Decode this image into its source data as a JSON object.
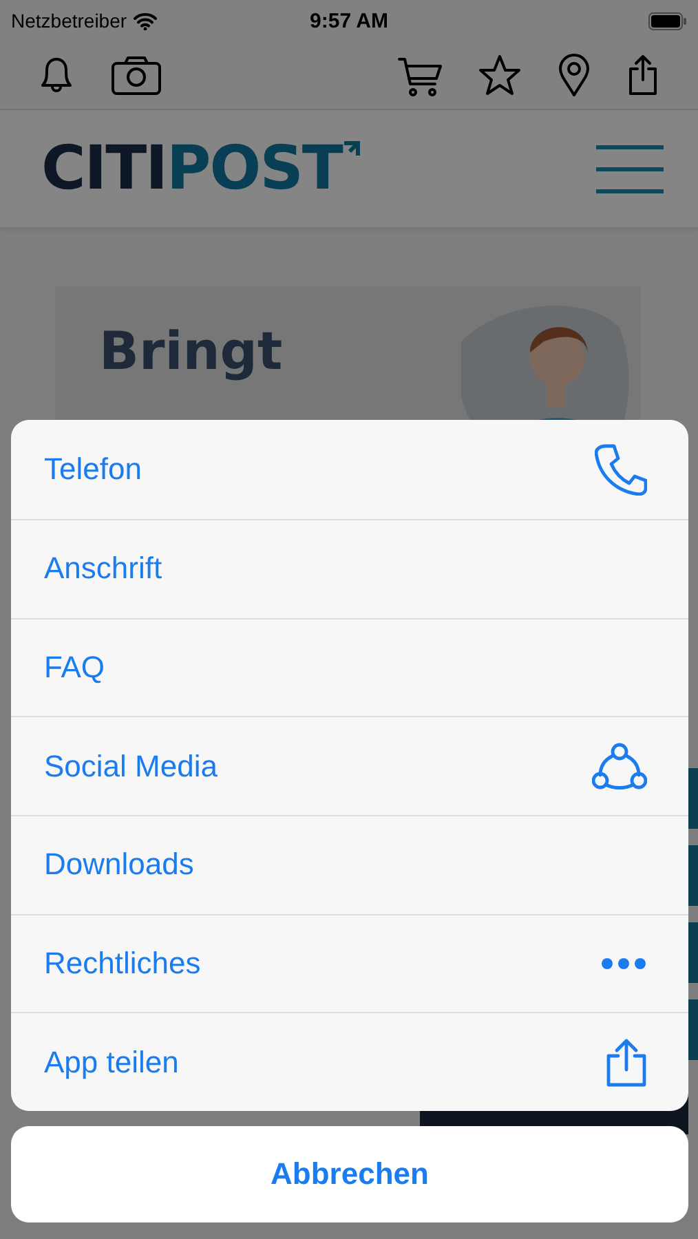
{
  "status_bar": {
    "carrier": "Netzbetreiber",
    "time": "9:57 AM"
  },
  "header": {
    "logo": [
      "CITI",
      "POST"
    ]
  },
  "hero": {
    "lines": [
      "Bringt"
    ]
  },
  "action_sheet": {
    "items": [
      {
        "label": "Telefon"
      },
      {
        "label": "Anschrift"
      },
      {
        "label": "FAQ"
      },
      {
        "label": "Social Media"
      },
      {
        "label": "Downloads"
      },
      {
        "label": "Rechtliches"
      },
      {
        "label": "App teilen"
      }
    ],
    "cancel": "Abbrechen"
  }
}
